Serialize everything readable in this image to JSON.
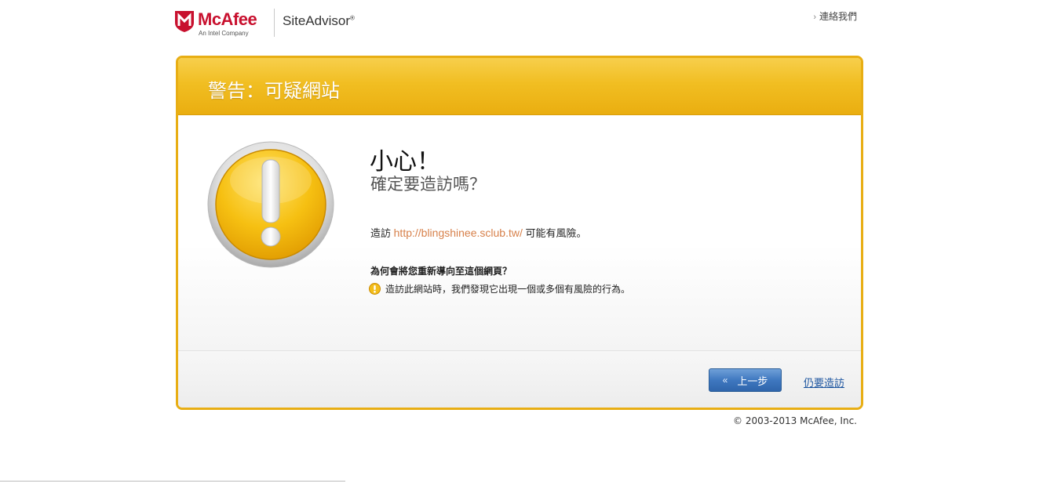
{
  "header": {
    "brand": "McAfee",
    "brand_sub": "An Intel Company",
    "product": "SiteAdvisor",
    "product_mark": "®",
    "contact_link": "連絡我們"
  },
  "panel": {
    "title": "警告：可疑網站",
    "caution": "小心！",
    "confirm": "確定要造訪嗎？",
    "visit_prefix": "造訪",
    "url": "http://blingshinee.sclub.tw/",
    "visit_suffix": "可能有風險。",
    "why_heading": "為何會將您重新導向至這個網頁？",
    "reason": "造訪此網站時，我們發現它出現一個或多個有風險的行為。",
    "back_button": "上一步",
    "visit_anyway": "仍要造訪"
  },
  "footer": {
    "copyright": "© 2003-2013 McAfee, Inc."
  },
  "colors": {
    "accent": "#e8ae14",
    "brand_red": "#c8102e",
    "url": "#d7804a",
    "button_blue": "#3f78c0",
    "link_blue": "#1e56a0"
  },
  "icons": {
    "logo": "mcafee-shield-icon",
    "warning_large": "exclamation-warning-icon",
    "warning_small": "exclamation-warning-small-icon",
    "back": "double-chevron-left-icon",
    "contact_chevron": "chevron-right-icon"
  }
}
